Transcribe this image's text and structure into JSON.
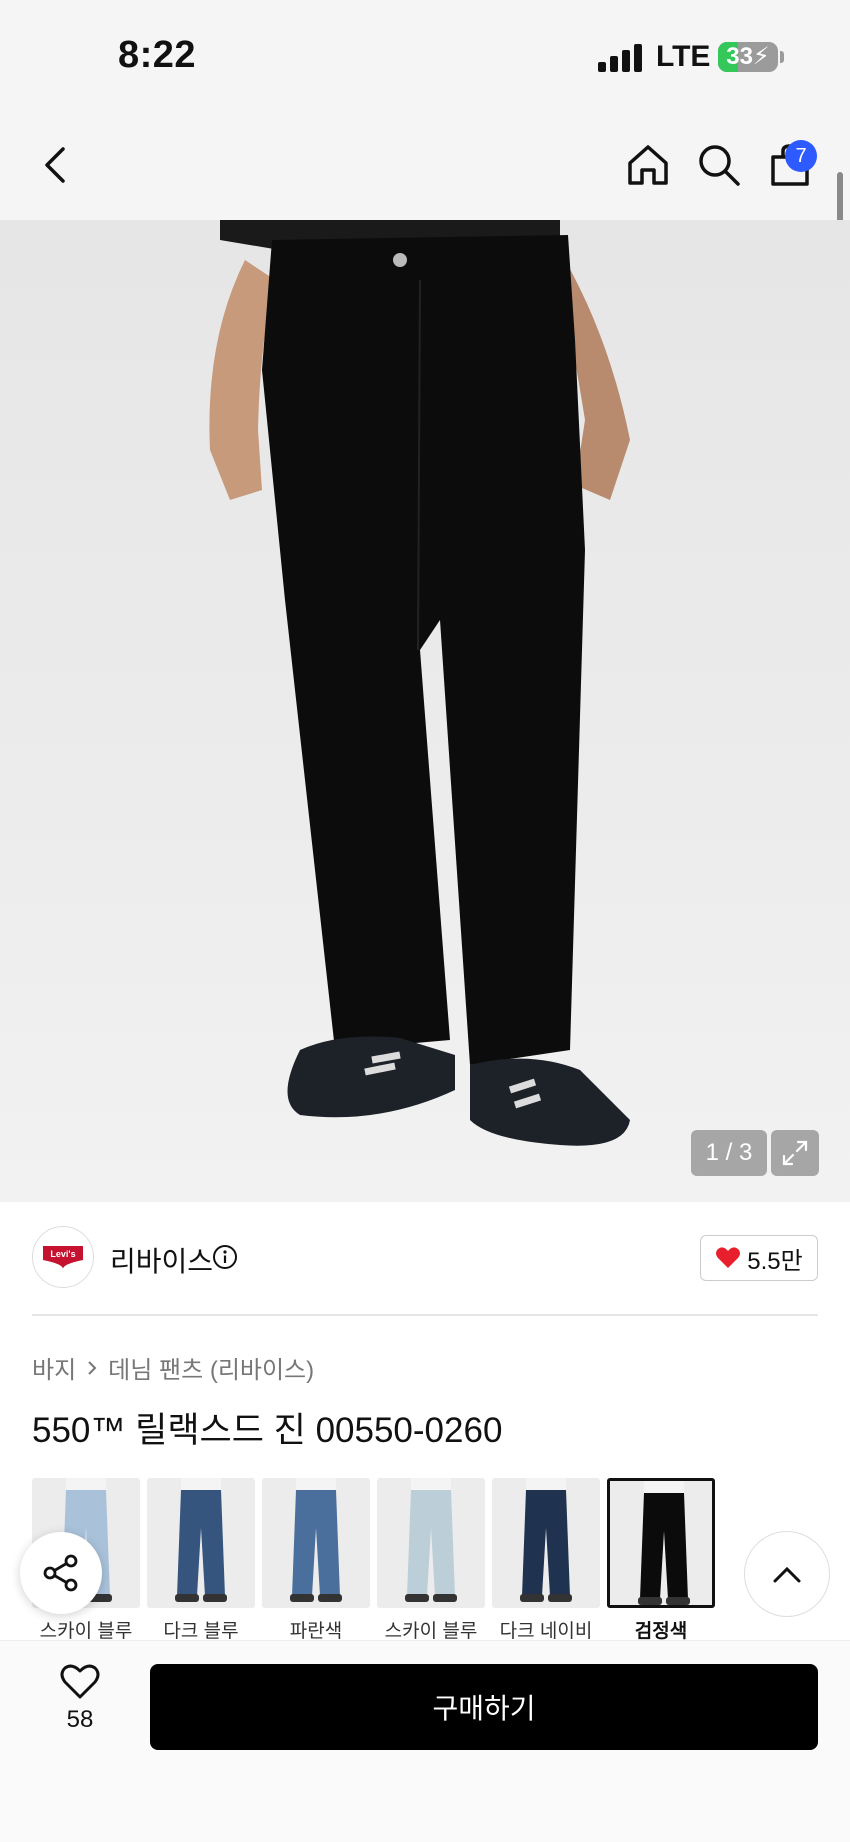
{
  "status_bar": {
    "time": "8:22",
    "network": "LTE",
    "battery_percent": 33,
    "battery_charging": true
  },
  "nav": {
    "cart_count": "7",
    "icons": [
      "back-icon",
      "home-icon",
      "search-icon",
      "bag-icon"
    ]
  },
  "gallery": {
    "counter": "1 / 3"
  },
  "brand": {
    "name": "리바이스",
    "logo_text": "Levi's",
    "like_count": "5.5만",
    "heart_color": "#e8202e"
  },
  "breadcrumb": {
    "category": "바지",
    "subcategory": "데님 팬츠 (리바이스)"
  },
  "product": {
    "title": "550™ 릴랙스드 진 00550-0260"
  },
  "swatches": [
    {
      "label": "스카이 블루",
      "color": "#a9c2da",
      "selected": false
    },
    {
      "label": "다크 블루",
      "color": "#35557e",
      "selected": false
    },
    {
      "label": "파란색",
      "color": "#4a6f9c",
      "selected": false
    },
    {
      "label": "스카이 블루",
      "color": "#bccfd8",
      "selected": false
    },
    {
      "label": "다크 네이비",
      "color": "#1f3350",
      "selected": false
    },
    {
      "label": "검정색",
      "color": "#0b0b0b",
      "selected": true
    }
  ],
  "bottom_bar": {
    "wish_count": "58",
    "buy_label": "구매하기"
  },
  "colors": {
    "accent_badge": "#2d5bff",
    "buy_button": "#000000",
    "battery_green": "#34c759"
  }
}
